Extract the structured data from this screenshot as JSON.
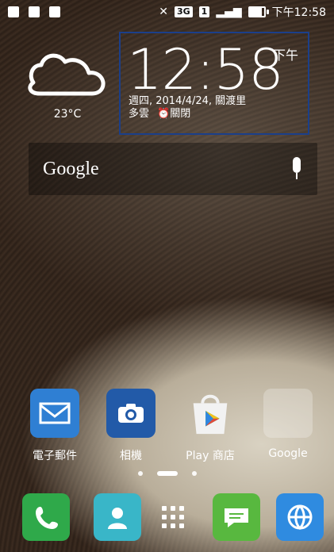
{
  "status_bar": {
    "time": "下午12:58",
    "network_badge": "3G",
    "sim_badge": "1"
  },
  "weather": {
    "temperature": "23°C",
    "icon": "cloud-icon"
  },
  "clock_widget": {
    "time": "12:58",
    "ampm": "下午",
    "date_line": "週四, 2014/4/24, 關渡里",
    "condition": "多雲",
    "alarm": "⏰關閉"
  },
  "search": {
    "label": "Google",
    "mic_icon": "microphone-icon"
  },
  "apps": [
    {
      "label": "電子郵件",
      "icon": "email-icon",
      "color": "#2f7fd3"
    },
    {
      "label": "相機",
      "icon": "camera-icon",
      "color": "#225aa8"
    },
    {
      "label": "Play 商店",
      "icon": "play-store-icon",
      "color": "#ffffff"
    },
    {
      "label": "Google",
      "icon": "google-folder-icon",
      "color": "#ffffff"
    }
  ],
  "dock": [
    {
      "icon": "phone-icon",
      "color": "#2fa94a"
    },
    {
      "icon": "contacts-icon",
      "color": "#39b6c8"
    },
    {
      "icon": "app-drawer-icon",
      "color": "#ffffff"
    },
    {
      "icon": "messages-icon",
      "color": "#58b83f"
    },
    {
      "icon": "browser-icon",
      "color": "#2f8be0"
    }
  ],
  "pager": {
    "pages": 3,
    "current": 2
  }
}
